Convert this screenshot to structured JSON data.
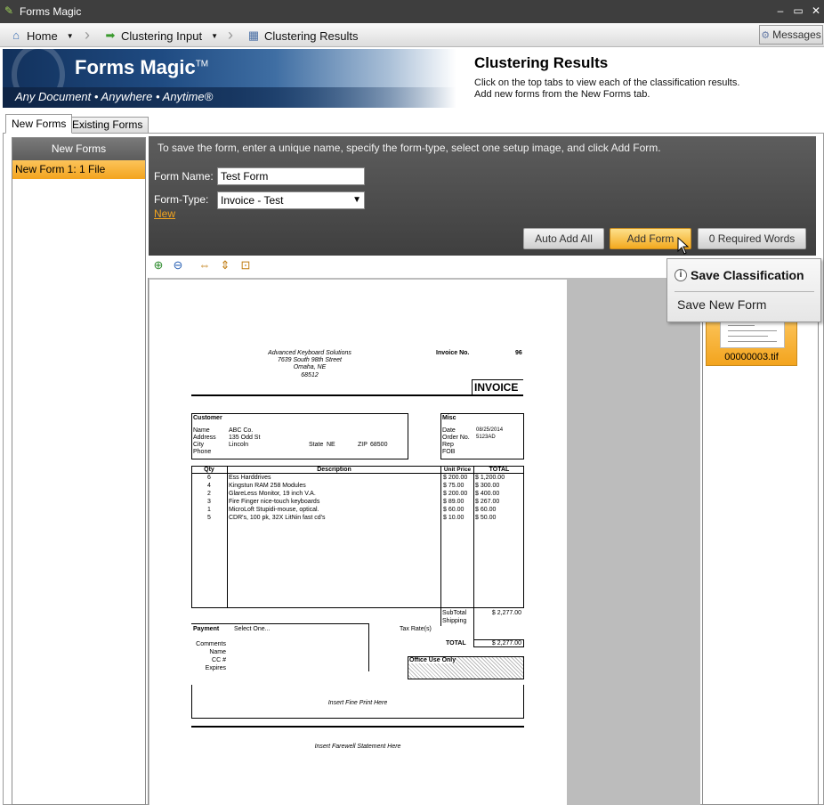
{
  "app": {
    "title": "Forms Magic"
  },
  "window_controls": {
    "minimize": "–",
    "maximize": "▭",
    "close": "✕"
  },
  "breadcrumbs": [
    {
      "label": "Home",
      "icon": "home-icon"
    },
    {
      "label": "Clustering Input",
      "icon": "green-arrow-icon"
    },
    {
      "label": "Clustering Results",
      "icon": "clustering-icon"
    }
  ],
  "messages_button": {
    "label": "Messages",
    "icon": "messages-icon"
  },
  "banner": {
    "logo_name": "Forms Magic",
    "logo_tm": "TM",
    "tagline": "Any Document • Anywhere • Anytime®",
    "title": "Clustering Results",
    "line1": "Click on the top tabs to view each of the classification results.",
    "line2": "Add new forms from the New Forms tab."
  },
  "tabs": {
    "new_forms": "New Forms",
    "existing_forms": "Existing Forms",
    "active": "new_forms"
  },
  "left_panel": {
    "header": "New Forms",
    "items": [
      "New Form 1: 1 File"
    ],
    "selected": 0
  },
  "form": {
    "instructions": "To save the form, enter a unique name, specify the form-type, select one setup image, and click Add Form.",
    "name_label": "Form Name:",
    "name_value": "Test Form",
    "type_label": "Form-Type:",
    "type_value": "Invoice - Test",
    "new_link": "New",
    "buttons": {
      "auto_add_all": "Auto Add All",
      "add_form": "Add Form",
      "required_words": "0 Required Words"
    }
  },
  "toolbar_icons": [
    "zoom-in-icon",
    "zoom-out-icon",
    "fit-width-icon",
    "fit-height-icon",
    "fit-page-icon"
  ],
  "popup_menu": {
    "title": "Save Classification",
    "items": [
      "Save New Form"
    ]
  },
  "thumbnail": {
    "filename": "00000003.tif"
  },
  "document": {
    "company": [
      "Advanced Keyboard Solutions",
      "7639 South 98th Street",
      "Omaha, NE",
      "68512"
    ],
    "invoice_no_label": "Invoice No.",
    "invoice_no": "96",
    "invoice_heading": "INVOICE",
    "customer": {
      "heading": "Customer",
      "labels": [
        "Name",
        "Address",
        "City",
        "Phone"
      ],
      "name": "ABC Co.",
      "address": "135 Odd St",
      "city": "Lincoln",
      "state_label": "State",
      "state": "NE",
      "zip_label": "ZIP",
      "zip": "68500"
    },
    "misc": {
      "heading": "Misc",
      "labels": [
        "Date",
        "Order No.",
        "Rep",
        "FOB"
      ],
      "date": "08/25/2014",
      "order_no": "5123AD"
    },
    "columns": [
      "Qty",
      "Description",
      "Unit Price",
      "TOTAL"
    ],
    "line_items": [
      {
        "qty": "6",
        "description": "Ess Harddrives",
        "unit_price": "$ 200.00",
        "total": "$ 1,200.00"
      },
      {
        "qty": "4",
        "description": "Kingstun RAM 258 Modules",
        "unit_price": "$ 75.00",
        "total": "$ 300.00"
      },
      {
        "qty": "2",
        "description": "GlareLess Monitor, 19 inch V.A.",
        "unit_price": "$ 200.00",
        "total": "$ 400.00"
      },
      {
        "qty": "3",
        "description": "Fire Finger nice-touch keyboards",
        "unit_price": "$ 89.00",
        "total": "$ 267.00"
      },
      {
        "qty": "1",
        "description": "MicroLoft Stupidi-mouse, optical.",
        "unit_price": "$ 60.00",
        "total": "$ 60.00"
      },
      {
        "qty": "5",
        "description": "CDR's, 100 pk, 32X LitNin fast cd's",
        "unit_price": "$ 10.00",
        "total": "$ 50.00"
      }
    ],
    "subtotal_label": "SubTotal",
    "subtotal": "$ 2,277.00",
    "shipping_label": "Shipping",
    "taxrate_label": "Tax Rate(s)",
    "total_label": "TOTAL",
    "total": "$ 2,277.00",
    "payment": {
      "heading": "Payment",
      "select": "Select One...",
      "labels": [
        "Comments",
        "Name",
        "CC #",
        "Expires"
      ]
    },
    "office_use": "Office Use Only",
    "fine_print": "Insert Fine Print Here",
    "farewell": "Insert Farewell Statement Here"
  }
}
